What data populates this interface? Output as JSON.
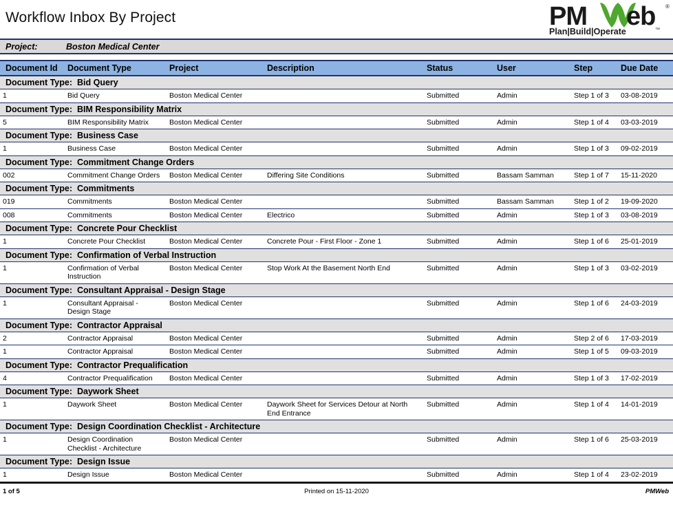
{
  "report": {
    "title": "Workflow Inbox By Project",
    "logo": {
      "name": "pmweb-logo",
      "wordmark_pm": "PM",
      "wordmark_w": "W",
      "wordmark_eb": "eb",
      "tagline": "Plan|Build|Operate",
      "trademark": "™",
      "accent_green": "#4ea72e",
      "accent_black": "#1a1a1a"
    },
    "project_row": {
      "label": "Project:",
      "value": "Boston Medical Center"
    },
    "columns": [
      "Document Id",
      "Document Type",
      "Project",
      "Description",
      "Status",
      "User",
      "Step",
      "Due Date"
    ],
    "group_prefix": "Document Type:",
    "groups": [
      {
        "name": "Bid Query",
        "rows": [
          {
            "id": "1",
            "type": "Bid Query",
            "project": "Boston Medical Center",
            "description": "",
            "status": "Submitted",
            "user": "Admin",
            "step": "Step 1 of 3",
            "due": "03-08-2019"
          }
        ]
      },
      {
        "name": "BIM Responsibility Matrix",
        "rows": [
          {
            "id": "5",
            "type": "BIM Responsibility Matrix",
            "project": "Boston Medical Center",
            "description": "",
            "status": "Submitted",
            "user": "Admin",
            "step": "Step 1 of 4",
            "due": "03-03-2019"
          }
        ]
      },
      {
        "name": "Business Case",
        "rows": [
          {
            "id": "1",
            "type": "Business Case",
            "project": "Boston Medical Center",
            "description": "",
            "status": "Submitted",
            "user": "Admin",
            "step": "Step 1 of 3",
            "due": "09-02-2019"
          }
        ]
      },
      {
        "name": "Commitment Change Orders",
        "rows": [
          {
            "id": "002",
            "type": "Commitment Change Orders",
            "project": "Boston Medical Center",
            "description": "Differing Site Conditions",
            "status": "Submitted",
            "user": "Bassam Samman",
            "step": "Step 1 of 7",
            "due": "15-11-2020"
          }
        ]
      },
      {
        "name": "Commitments",
        "rows": [
          {
            "id": "019",
            "type": "Commitments",
            "project": "Boston Medical Center",
            "description": "",
            "status": "Submitted",
            "user": "Bassam Samman",
            "step": "Step 1 of 2",
            "due": "19-09-2020"
          },
          {
            "id": "008",
            "type": "Commitments",
            "project": "Boston Medical Center",
            "description": "Electrico",
            "status": "Submitted",
            "user": "Admin",
            "step": "Step 1 of 3",
            "due": "03-08-2019"
          }
        ]
      },
      {
        "name": "Concrete Pour Checklist",
        "rows": [
          {
            "id": "1",
            "type": "Concrete Pour Checklist",
            "project": "Boston Medical Center",
            "description": "Concrete Pour - First Floor - Zone 1",
            "status": "Submitted",
            "user": "Admin",
            "step": "Step 1 of 6",
            "due": "25-01-2019"
          }
        ]
      },
      {
        "name": "Confirmation of Verbal Instruction",
        "rows": [
          {
            "id": "1",
            "type": "Confirmation of Verbal Instruction",
            "project": "Boston Medical Center",
            "description": "Stop Work At the Basement North End",
            "status": "Submitted",
            "user": "Admin",
            "step": "Step 1 of 3",
            "due": "03-02-2019"
          }
        ]
      },
      {
        "name": "Consultant Appraisal - Design Stage",
        "rows": [
          {
            "id": "1",
            "type": "Consultant Appraisal - Design Stage",
            "project": "Boston Medical Center",
            "description": "",
            "status": "Submitted",
            "user": "Admin",
            "step": "Step 1 of 6",
            "due": "24-03-2019"
          }
        ]
      },
      {
        "name": "Contractor Appraisal",
        "rows": [
          {
            "id": "2",
            "type": "Contractor Appraisal",
            "project": "Boston Medical Center",
            "description": "",
            "status": "Submitted",
            "user": "Admin",
            "step": "Step 2 of 6",
            "due": "17-03-2019"
          },
          {
            "id": "1",
            "type": "Contractor Appraisal",
            "project": "Boston Medical Center",
            "description": "",
            "status": "Submitted",
            "user": "Admin",
            "step": "Step 1 of 5",
            "due": "09-03-2019"
          }
        ]
      },
      {
        "name": "Contractor Prequalification",
        "rows": [
          {
            "id": "4",
            "type": "Contractor Prequalification",
            "project": "Boston Medical Center",
            "description": "",
            "status": "Submitted",
            "user": "Admin",
            "step": "Step 1 of 3",
            "due": "17-02-2019"
          }
        ]
      },
      {
        "name": "Daywork Sheet",
        "rows": [
          {
            "id": "1",
            "type": "Daywork Sheet",
            "project": "Boston Medical Center",
            "description": "Daywork Sheet for Services Detour at North End Entrance",
            "status": "Submitted",
            "user": "Admin",
            "step": "Step 1 of 4",
            "due": "14-01-2019"
          }
        ]
      },
      {
        "name": "Design Coordination Checklist - Architecture",
        "rows": [
          {
            "id": "1",
            "type": "Design Coordination Checklist - Architecture",
            "project": "Boston Medical Center",
            "description": "",
            "status": "Submitted",
            "user": "Admin",
            "step": "Step 1 of 6",
            "due": "25-03-2019"
          }
        ]
      },
      {
        "name": "Design Issue",
        "rows": [
          {
            "id": "1",
            "type": "Design Issue",
            "project": "Boston Medical Center",
            "description": "",
            "status": "Submitted",
            "user": "Admin",
            "step": "Step 1 of 4",
            "due": "23-02-2019"
          }
        ]
      }
    ],
    "footer": {
      "page": "1 of 5",
      "printed": "Printed on 15-11-2020",
      "brand": "PMWeb"
    }
  }
}
